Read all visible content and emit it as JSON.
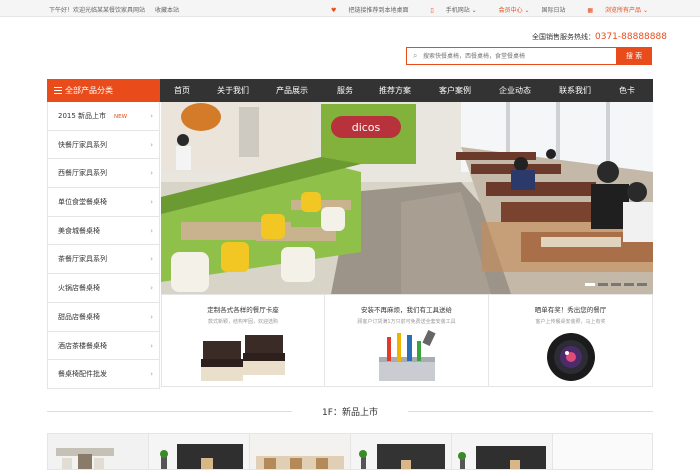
{
  "topbar": {
    "greeting": "下午好！欢迎光临某某餐饮家具网站",
    "favorite": "收藏本站",
    "weixin": "把链接推荐到本地桌面",
    "mobile": "手机网站",
    "member": "会员中心",
    "intl": "国际日站",
    "all_products": "浏览所有产品"
  },
  "header": {
    "hotline_label": "全国销售服务热线：",
    "hotline_number": "0371-88888888",
    "search_placeholder": "搜索快餐桌椅，西餐桌椅，食堂餐桌椅",
    "search_button": "搜 索"
  },
  "category": {
    "title": "全部产品分类",
    "items": [
      {
        "label": "2015 新品上市",
        "badge": "NEW"
      },
      {
        "label": "快餐厅家具系列"
      },
      {
        "label": "西餐厅家具系列"
      },
      {
        "label": "单位食堂餐桌椅"
      },
      {
        "label": "美食城餐桌椅"
      },
      {
        "label": "茶餐厅家具系列"
      },
      {
        "label": "火锅店餐桌椅"
      },
      {
        "label": "甜品店餐桌椅"
      },
      {
        "label": "酒店茶楼餐桌椅"
      },
      {
        "label": "餐桌椅配件批发"
      }
    ]
  },
  "nav": {
    "items": [
      "首页",
      "关于我们",
      "产品展示",
      "服务",
      "推荐方案",
      "客户案例",
      "企业动态",
      "联系我们",
      "色卡"
    ]
  },
  "banner": {
    "sign_text": "dicos",
    "slides": 5,
    "active_slide": 1
  },
  "features": [
    {
      "title": "定制各式各样的餐厅卡座",
      "sub": "款式新颖，结构牢固，欢迎选购"
    },
    {
      "title": "安装不再麻烦，我们有工具送给",
      "sub": "顾客户订货满1万只前可免费送全套安装工具"
    },
    {
      "title": "晒单有奖！秀出您的餐厅",
      "sub": "客户上传餐桌安装照，马上有奖"
    }
  ],
  "floor": {
    "title": "1F：新品上市"
  },
  "colors": {
    "accent": "#e94b1b",
    "nav_bg": "#333333"
  }
}
